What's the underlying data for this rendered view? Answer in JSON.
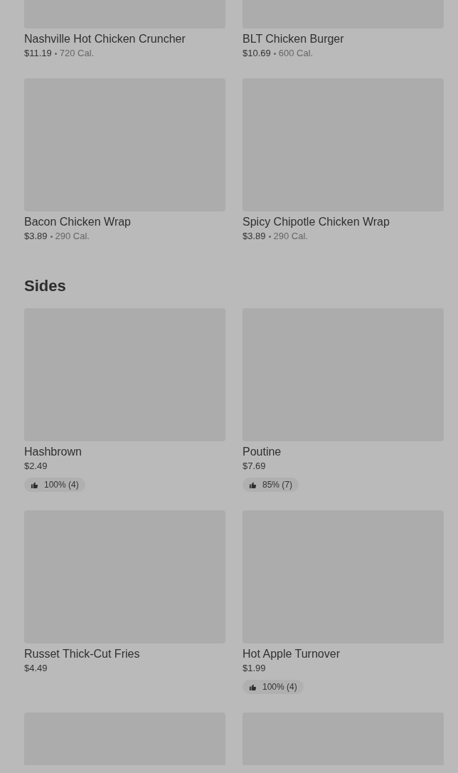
{
  "sections": [
    {
      "items": [
        {
          "kind": "dish",
          "name": "Nashville Hot Chicken Cruncher",
          "price": "$11.19",
          "calories": "720 Cal."
        },
        {
          "kind": "dish",
          "name": "BLT Chicken Burger",
          "price": "$10.69",
          "calories": "600 Cal."
        },
        {
          "kind": "dish",
          "name": "Bacon Chicken Wrap",
          "price": "$3.89",
          "calories": "290 Cal."
        },
        {
          "kind": "dish",
          "name": "Spicy Chipotle Chicken Wrap",
          "price": "$3.89",
          "calories": "290 Cal."
        }
      ]
    },
    {
      "title": "Sides",
      "items": [
        {
          "kind": "dish",
          "name": "Hashbrown",
          "price": "$2.49",
          "rating": "100% (4)"
        },
        {
          "kind": "dish",
          "name": "Poutine",
          "price": "$7.69",
          "rating": "85% (7)"
        },
        {
          "kind": "dish",
          "name": "Russet Thick-Cut Fries",
          "price": "$4.49"
        },
        {
          "kind": "dish",
          "name": "Hot Apple Turnover",
          "price": "$1.99",
          "rating": "100% (4)"
        },
        {
          "kind": "image_only"
        },
        {
          "kind": "image_only"
        }
      ]
    }
  ]
}
